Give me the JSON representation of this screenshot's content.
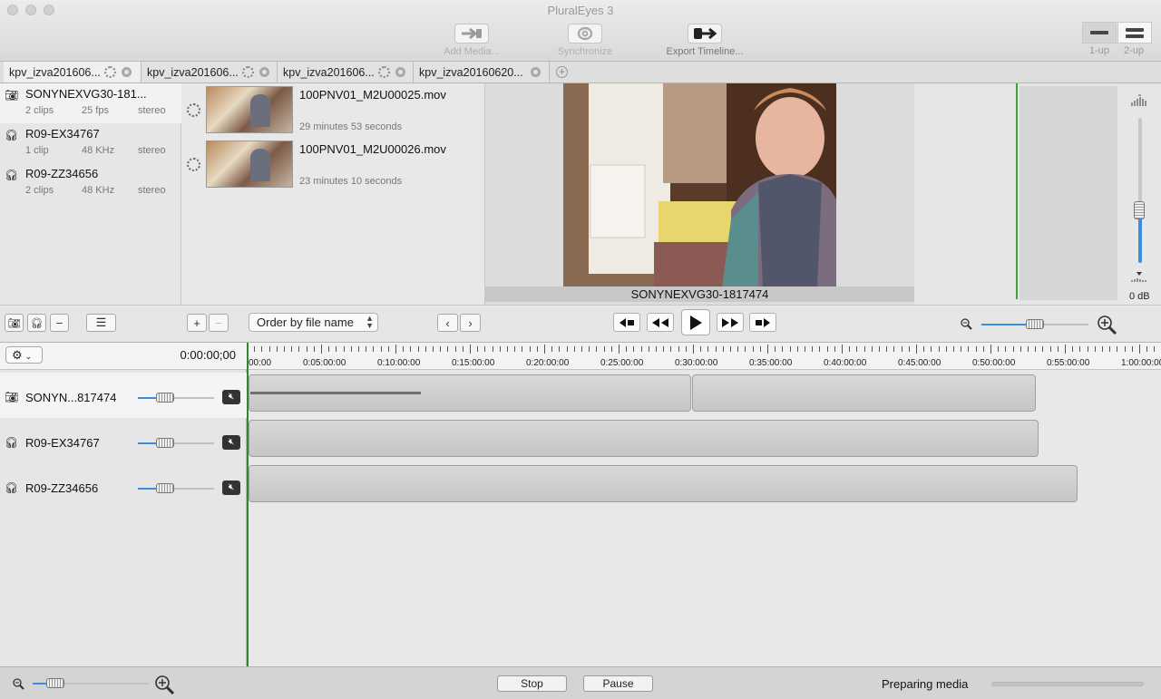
{
  "window": {
    "title": "PluralEyes 3"
  },
  "toolbar": {
    "add_media": "Add Media...",
    "synchronize": "Synchronize",
    "export_timeline": "Export Timeline...",
    "layout_1up": "1-up",
    "layout_2up": "2-up"
  },
  "tabs": [
    {
      "label": "kpv_izva201606..."
    },
    {
      "label": "kpv_izva201606..."
    },
    {
      "label": "kpv_izva201606..."
    },
    {
      "label": "kpv_izva20160620..."
    }
  ],
  "devices": [
    {
      "name": "SONYNEXVG30-181...",
      "clips": "2 clips",
      "rate": "25 fps",
      "channels": "stereo",
      "icon": "camera-icon"
    },
    {
      "name": "R09-EX34767",
      "clips": "1 clip",
      "rate": "48 KHz",
      "channels": "stereo",
      "icon": "headphones-icon"
    },
    {
      "name": "R09-ZZ34656",
      "clips": "2 clips",
      "rate": "48 KHz",
      "channels": "stereo",
      "icon": "headphones-icon"
    }
  ],
  "clips": [
    {
      "filename": "100PNV01_M2U00025.mov",
      "duration": "29 minutes 53 seconds"
    },
    {
      "filename": "100PNV01_M2U00026.mov",
      "duration": "23 minutes 10 seconds"
    }
  ],
  "preview": {
    "label": "SONYNEXVG30-1817474"
  },
  "meter": {
    "db_label": "0 dB"
  },
  "clip_list": {
    "order_label": "Order by file name"
  },
  "timeline": {
    "timecode": "0:00:00;00",
    "ruler": [
      "00:00",
      "0:05:00:00",
      "0:10:00:00",
      "0:15:00:00",
      "0:20:00:00",
      "0:25:00:00",
      "0:30:00:00",
      "0:35:00:00",
      "0:40:00:00",
      "0:45:00:00",
      "0:50:00:00",
      "0:55:00:00",
      "1:00:00:00"
    ],
    "tracks": [
      {
        "name": "SONYN...817474",
        "icon": "camera-icon"
      },
      {
        "name": "R09-EX34767",
        "icon": "headphones-icon"
      },
      {
        "name": "R09-ZZ34656",
        "icon": "headphones-icon"
      }
    ]
  },
  "status": {
    "stop_label": "Stop",
    "pause_label": "Pause",
    "message": "Preparing media"
  },
  "colors": {
    "accent": "#3b8de0",
    "playhead": "#2b8a2b"
  }
}
